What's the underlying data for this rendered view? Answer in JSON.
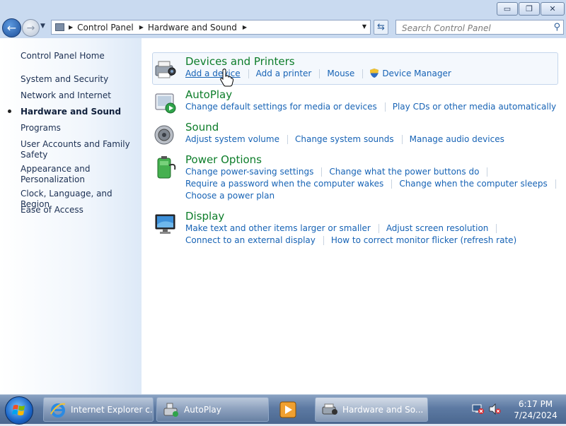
{
  "window": {
    "buttons": {
      "minimize": "▭",
      "maximize": "❐",
      "close": "✕"
    }
  },
  "nav": {
    "breadcrumbs": [
      "Control Panel",
      "Hardware and Sound"
    ],
    "search_placeholder": "Search Control Panel"
  },
  "left_pane": {
    "items": [
      {
        "label": "Control Panel Home"
      },
      {
        "label": "System and Security"
      },
      {
        "label": "Network and Internet"
      },
      {
        "label": "Hardware and Sound",
        "active": true
      },
      {
        "label": "Programs"
      },
      {
        "label": "User Accounts and Family Safety"
      },
      {
        "label": "Appearance and Personalization"
      },
      {
        "label": "Clock, Language, and Region"
      },
      {
        "label": "Ease of Access"
      }
    ]
  },
  "categories": {
    "devices": {
      "title": "Devices and Printers",
      "icon": "printer-camera-icon",
      "links": [
        "Add a device",
        "Add a printer",
        "Mouse",
        "Device Manager"
      ]
    },
    "autoplay": {
      "title": "AutoPlay",
      "icon": "autoplay-icon",
      "links": [
        "Change default settings for media or devices",
        "Play CDs or other media automatically"
      ]
    },
    "sound": {
      "title": "Sound",
      "icon": "speaker-icon",
      "links": [
        "Adjust system volume",
        "Change system sounds",
        "Manage audio devices"
      ]
    },
    "power": {
      "title": "Power Options",
      "icon": "battery-icon",
      "links": [
        "Change power-saving settings",
        "Change what the power buttons do",
        "Require a password when the computer wakes",
        "Change when the computer sleeps",
        "Choose a power plan"
      ]
    },
    "display": {
      "title": "Display",
      "icon": "monitor-icon",
      "links": [
        "Make text and other items larger or smaller",
        "Adjust screen resolution",
        "Connect to an external display",
        "How to correct monitor flicker (refresh rate)"
      ]
    }
  },
  "taskbar": {
    "tasks": [
      {
        "label": "Internet Explorer c...",
        "icon": "ie-icon"
      },
      {
        "label": "AutoPlay",
        "icon": "autoplay-icon"
      },
      {
        "label": "",
        "icon": "media-player-icon"
      },
      {
        "label": "Hardware and So...",
        "icon": "control-panel-icon"
      }
    ],
    "time": "6:17 PM",
    "date": "7/24/2024"
  }
}
